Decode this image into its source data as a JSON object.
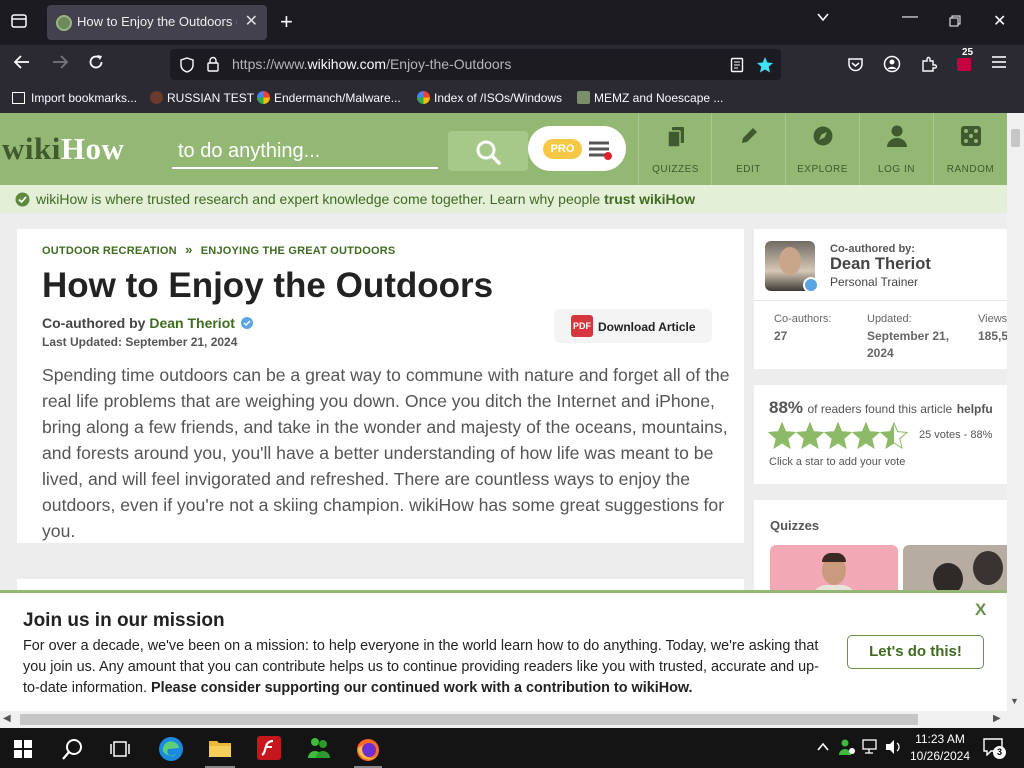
{
  "browser": {
    "tab_title": "How to Enjoy the Outdoors (wi",
    "url_prefix": "https://www.",
    "url_host": "wikihow.com",
    "url_path": "/Enjoy-the-Outdoors",
    "extension_badge": "25",
    "bookmarks": [
      "Import bookmarks...",
      "RUSSIAN TEST",
      "Endermanch/Malware...",
      "Index of /ISOs/Windows",
      "MEMZ and Noescape ..."
    ]
  },
  "site": {
    "logo_wiki": "wiki",
    "logo_how": "How",
    "search_placeholder": "to do anything...",
    "pro_label": "PRO",
    "nav": [
      {
        "label": "QUIZZES",
        "icon": "quizzes-icon"
      },
      {
        "label": "EDIT",
        "icon": "pencil-icon"
      },
      {
        "label": "EXPLORE",
        "icon": "compass-icon"
      },
      {
        "label": "LOG IN",
        "icon": "user-icon"
      },
      {
        "label": "RANDOM",
        "icon": "dice-icon"
      }
    ],
    "trust_text": "wikiHow is where trusted research and expert knowledge come together. Learn why people",
    "trust_link": "trust wikiHow",
    "colors": {
      "brand_green": "#93b874",
      "dark_green": "#3f6b22"
    }
  },
  "article": {
    "breadcrumb_1": "OUTDOOR RECREATION",
    "breadcrumb_sep": "»",
    "breadcrumb_2": "ENJOYING THE GREAT OUTDOORS",
    "title": "How to Enjoy the Outdoors",
    "coauthored_prefix": "Co-authored by",
    "author": "Dean Theriot",
    "last_updated": "Last Updated: September 21, 2024",
    "download_label": "Download Article",
    "pdf_label": "PDF",
    "intro": "Spending time outdoors can be a great way to commune with nature and forget all of the real life problems that are weighing you down. Once you ditch the Internet and iPhone, bring along a few friends, and take in the wonder and majesty of the oceans, mountains, and forests around you, you'll have a better understanding of how life was meant to be lived, and will feel invigorated and refreshed. There are countless ways to enjoy the outdoors, even if you're not a skiing champion. wikiHow has some great suggestions for you."
  },
  "sidebar": {
    "coauthored_label": "Co-authored by:",
    "author_name": "Dean Theriot",
    "author_role": "Personal Trainer",
    "coauthors_label": "Co-authors:",
    "coauthors_value": "27",
    "updated_label": "Updated:",
    "updated_value_1": "September 21,",
    "updated_value_2": "2024",
    "views_label": "Views",
    "views_value": "185,5",
    "helpful_percent": "88%",
    "helpful_text": "of readers found this article",
    "helpful_bold": "helpfu",
    "votes_text": "25 votes - 88%",
    "star_rating": 4.5,
    "click_star": "Click a star to add your vote",
    "quizzes_label": "Quizzes"
  },
  "banner": {
    "title": "Join us in our mission",
    "text": "For over a decade, we've been on a mission: to help everyone in the world learn how to do anything. Today, we're asking that you join us. Any amount that you can contribute helps us to continue providing readers like you with trusted, accurate and up-to-date information.",
    "bold": "Please consider supporting our continued work with a contribution to wikiHow.",
    "button": "Let's do this!",
    "close": "X"
  },
  "taskbar": {
    "time": "11:23 AM",
    "date": "10/26/2024",
    "notification_count": "3"
  }
}
